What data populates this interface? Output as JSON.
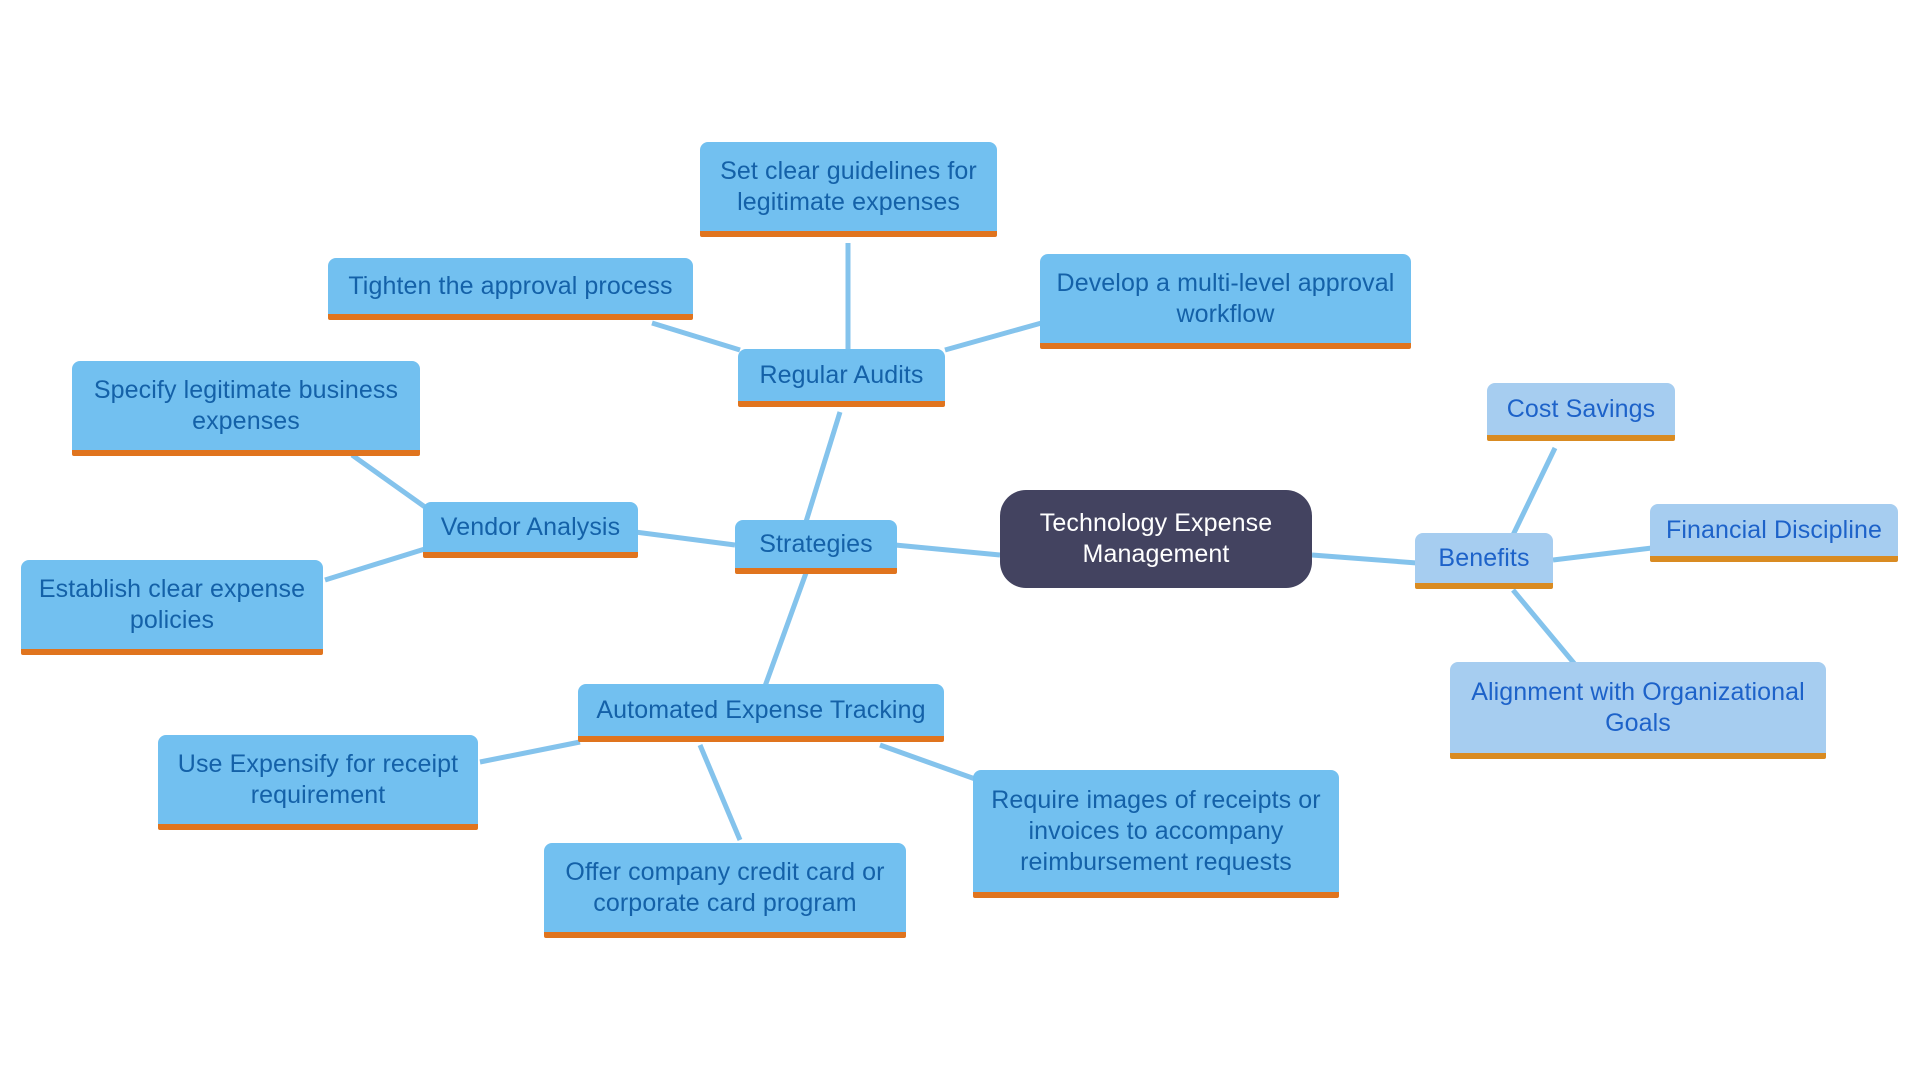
{
  "diagram": {
    "type": "mind-map",
    "title": "Technology Expense Management",
    "background_color": "#ffffff",
    "colors": {
      "root_fill": "#434360",
      "root_text": "#ffffff",
      "branch_a_fill": "#72c0f0",
      "branch_a_text": "#1461a8",
      "branch_a_underline": "#e0741e",
      "branch_b_fill": "#a6cdf0",
      "branch_b_text": "#1d62c9",
      "branch_b_underline": "#d98b22",
      "edge": "#84c3ec"
    }
  },
  "nodes": {
    "root": {
      "label": "Technology Expense\nManagement"
    },
    "strategies": {
      "label": "Strategies"
    },
    "benefits": {
      "label": "Benefits"
    },
    "regular_audits": {
      "label": "Regular Audits"
    },
    "vendor_analysis": {
      "label": "Vendor Analysis"
    },
    "automated_expense_tracking": {
      "label": "Automated Expense Tracking"
    },
    "set_clear_guidelines": {
      "label": "Set clear guidelines for\nlegitimate expenses"
    },
    "tighten_approval": {
      "label": "Tighten the approval process"
    },
    "multi_level_workflow": {
      "label": "Develop a multi-level approval\nworkflow"
    },
    "specify_legitimate": {
      "label": "Specify legitimate business\nexpenses"
    },
    "establish_policies": {
      "label": "Establish clear expense\npolicies"
    },
    "use_expensify": {
      "label": "Use Expensify for receipt\nrequirement"
    },
    "company_credit_card": {
      "label": "Offer company credit card or\ncorporate card program"
    },
    "require_images": {
      "label": "Require images of receipts or\ninvoices to accompany\nreimbursement requests"
    },
    "cost_savings": {
      "label": "Cost Savings"
    },
    "financial_discipline": {
      "label": "Financial Discipline"
    },
    "alignment_goals": {
      "label": "Alignment with Organizational\nGoals"
    }
  }
}
